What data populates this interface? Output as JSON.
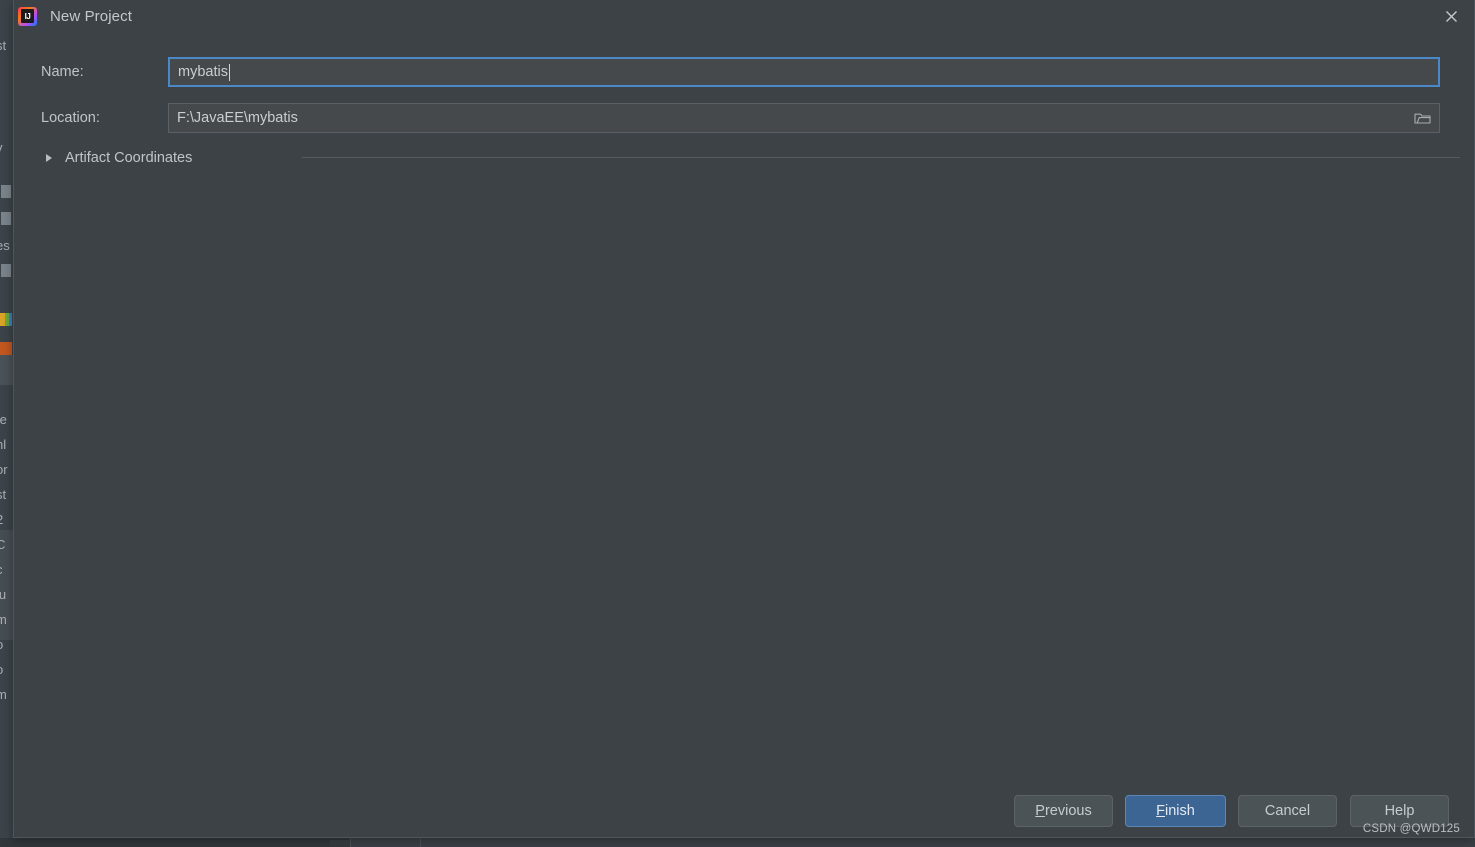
{
  "window": {
    "title": "New Project",
    "app_icon": "intellij-idea-icon",
    "close_icon": "close-icon"
  },
  "form": {
    "name": {
      "label": "Name:",
      "value": "mybatis",
      "focused": true
    },
    "location": {
      "label": "Location:",
      "value": "F:\\JavaEE\\mybatis",
      "browse_icon": "folder-icon"
    },
    "artifact_section": {
      "label": "Artifact Coordinates",
      "expanded": false,
      "arrow_icon": "chevron-right-icon"
    }
  },
  "buttons": {
    "previous": {
      "label": "Previous",
      "mnemonic": "P",
      "rest": "revious"
    },
    "finish": {
      "label": "Finish",
      "mnemonic": "F",
      "rest": "inish"
    },
    "cancel": {
      "label": "Cancel"
    },
    "help": {
      "label": "Help"
    }
  },
  "watermark": "CSDN @QWD125",
  "colors": {
    "dialog_background": "#3c4245",
    "field_background": "#45494c",
    "focus_border": "#4a88c7",
    "primary_button": "#3c6594",
    "primary_button_border": "#5b86b5",
    "text": "#c3c8cc"
  },
  "background_ide": {
    "left_strip_fragments": [
      "st",
      "v",
      "es",
      "te",
      "nl",
      "or",
      "st",
      "2",
      "C",
      "c",
      "ju",
      "m",
      "o",
      "o",
      "m"
    ],
    "swatches": [
      "#d9a326",
      "#6aab3a",
      "#3b7fc4",
      "#c2571f"
    ]
  }
}
